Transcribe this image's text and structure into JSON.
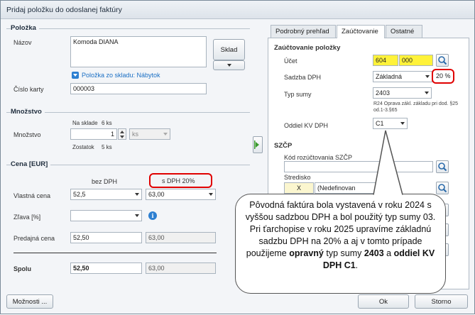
{
  "window": {
    "title": "Pridaj položku do odoslanej faktúry"
  },
  "polozka": {
    "section_title": "Položka",
    "name_label": "Názov",
    "name_value": "Komoda DIANA",
    "sklad_button": "Sklad",
    "link_text": "Položka zo skladu: Nábytok",
    "card_label": "Číslo karty",
    "card_value": "000003"
  },
  "mnozstvo": {
    "section_title": "Množstvo",
    "na_sklade": "Na sklade",
    "na_sklade_value": "6 ks",
    "label": "Množstvo",
    "value": "1",
    "unit": "ks",
    "zostatok": "Zostatok",
    "zostatok_value": "5 ks"
  },
  "cena": {
    "section_title": "Cena [EUR]",
    "col_bez": "bez DPH",
    "col_s": "s DPH 20%",
    "vlastna_label": "Vlastná cena",
    "vlastna_bez": "52,5",
    "vlastna_s": "63,00",
    "zlava_label": "Zľava [%]",
    "predajna_label": "Predajná cena",
    "predajna_bez": "52,50",
    "predajna_s": "63,00",
    "spolu_label": "Spolu",
    "spolu_bez": "52,50",
    "spolu_s": "63,00"
  },
  "tabs": [
    "Podrobný prehľad",
    "Zaúčtovanie",
    "Ostatné"
  ],
  "zauctovanie": {
    "section_title": "Zaúčtovanie položky",
    "ucet_label": "Účet",
    "ucet_value": "604",
    "ucet_sub": "000",
    "sadzba_label": "Sadzba DPH",
    "sadzba_value": "Základná",
    "sadzba_pct": "20 %",
    "typ_label": "Typ sumy",
    "typ_value": "2403",
    "typ_desc": "R24 Oprava zákl. základu pri dod. §25 od.1-3.§65",
    "kv_label": "Oddiel KV DPH",
    "kv_value": "C1"
  },
  "szcp": {
    "section_title": "SZČP",
    "kod_label": "Kód rozúčtovania SZČP",
    "stredisko_label": "Stredisko",
    "stredisko_code": "X",
    "stredisko_value": "(Nedefinovan"
  },
  "callout": {
    "text_1": "Pôvodná faktúra bola vystavená v roku 2024 s vyššou sadzbou DPH a bol použitý typ sumy 03. Pri ťarchopise v roku 2025 upravíme základnú sadzbu DPH na 20% a aj v tomto prípade použijeme ",
    "bold_1": "opravný",
    "text_2": " typ sumy ",
    "bold_2": "2403",
    "text_3": " a ",
    "bold_3": "oddiel KV DPH C1",
    "text_4": "."
  },
  "footer": {
    "moznosti": "Možnosti ...",
    "ok": "Ok",
    "storno": "Storno"
  },
  "colors": {
    "highlight": "#fff23a",
    "annotation_red": "#e00000",
    "link_blue": "#1a6fc4"
  }
}
